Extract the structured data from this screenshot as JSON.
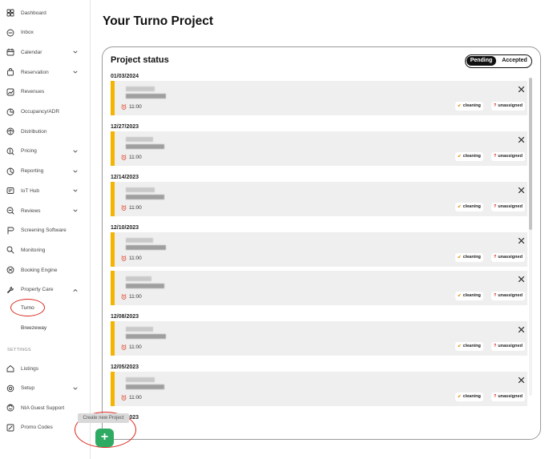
{
  "sidebar": {
    "items": [
      {
        "label": "Dashboard",
        "icon": "dashboard-icon",
        "chevron": false
      },
      {
        "label": "Inbox",
        "icon": "chat-icon",
        "chevron": false
      },
      {
        "label": "Calendar",
        "icon": "calendar-icon",
        "chevron": true
      },
      {
        "label": "Reservation",
        "icon": "bag-icon",
        "chevron": true
      },
      {
        "label": "Revenues",
        "icon": "trend-icon",
        "chevron": false
      },
      {
        "label": "Occupancy/ADR",
        "icon": "pie-icon",
        "chevron": false
      },
      {
        "label": "Distribution",
        "icon": "network-icon",
        "chevron": false
      },
      {
        "label": "Pricing",
        "icon": "dollar-icon",
        "chevron": true
      },
      {
        "label": "Reporting",
        "icon": "chart-icon",
        "chevron": true
      },
      {
        "label": "IoT Hub",
        "icon": "iot-icon",
        "chevron": true
      },
      {
        "label": "Reviews",
        "icon": "review-icon",
        "chevron": true
      },
      {
        "label": "Screening Software",
        "icon": "flag-icon",
        "chevron": false
      },
      {
        "label": "Monitoring",
        "icon": "search-icon",
        "chevron": false
      },
      {
        "label": "Booking Engine",
        "icon": "globe-icon",
        "chevron": false
      },
      {
        "label": "Property Care",
        "icon": "wrench-icon",
        "chevron": true
      }
    ],
    "sub_items": [
      "Turno",
      "Breezeway"
    ],
    "settings_label": "SETTINGS",
    "settings_items": [
      {
        "label": "Listings",
        "icon": "home-icon",
        "chevron": false
      },
      {
        "label": "Setup",
        "icon": "gear-icon",
        "chevron": true
      },
      {
        "label": "NIA Guest Support",
        "icon": "support-icon",
        "chevron": false
      },
      {
        "label": "Promo Codes",
        "icon": "percent-icon",
        "chevron": false
      }
    ]
  },
  "main": {
    "title": "Your Turno Project"
  },
  "project_status": {
    "title": "Project status",
    "toggle": {
      "active": "Pending",
      "inactive": "Accepted"
    },
    "groups": [
      {
        "date": "01/03/2024",
        "tasks": [
          {
            "time": "11:00",
            "type": "cleaning",
            "status": "unassigned"
          }
        ]
      },
      {
        "date": "12/27/2023",
        "tasks": [
          {
            "time": "11:00",
            "type": "cleaning",
            "status": "unassigned"
          }
        ]
      },
      {
        "date": "12/14/2023",
        "tasks": [
          {
            "time": "11:00",
            "type": "cleaning",
            "status": "unassigned"
          }
        ]
      },
      {
        "date": "12/10/2023",
        "tasks": [
          {
            "time": "11:00",
            "type": "cleaning",
            "status": "unassigned"
          },
          {
            "time": "11:00",
            "type": "cleaning",
            "status": "unassigned"
          }
        ]
      },
      {
        "date": "12/08/2023",
        "tasks": [
          {
            "time": "11:00",
            "type": "cleaning",
            "status": "unassigned"
          }
        ]
      },
      {
        "date": "12/05/2023",
        "tasks": [
          {
            "time": "11:00",
            "type": "cleaning",
            "status": "unassigned"
          }
        ]
      },
      {
        "date": "12/02/2023",
        "tasks": []
      }
    ]
  },
  "fab": {
    "tooltip": "Create new Project",
    "icon": "plus-icon",
    "color": "#2faa62"
  },
  "colors": {
    "accent_bar": "#f4b400",
    "annotation": "#d9251c"
  }
}
